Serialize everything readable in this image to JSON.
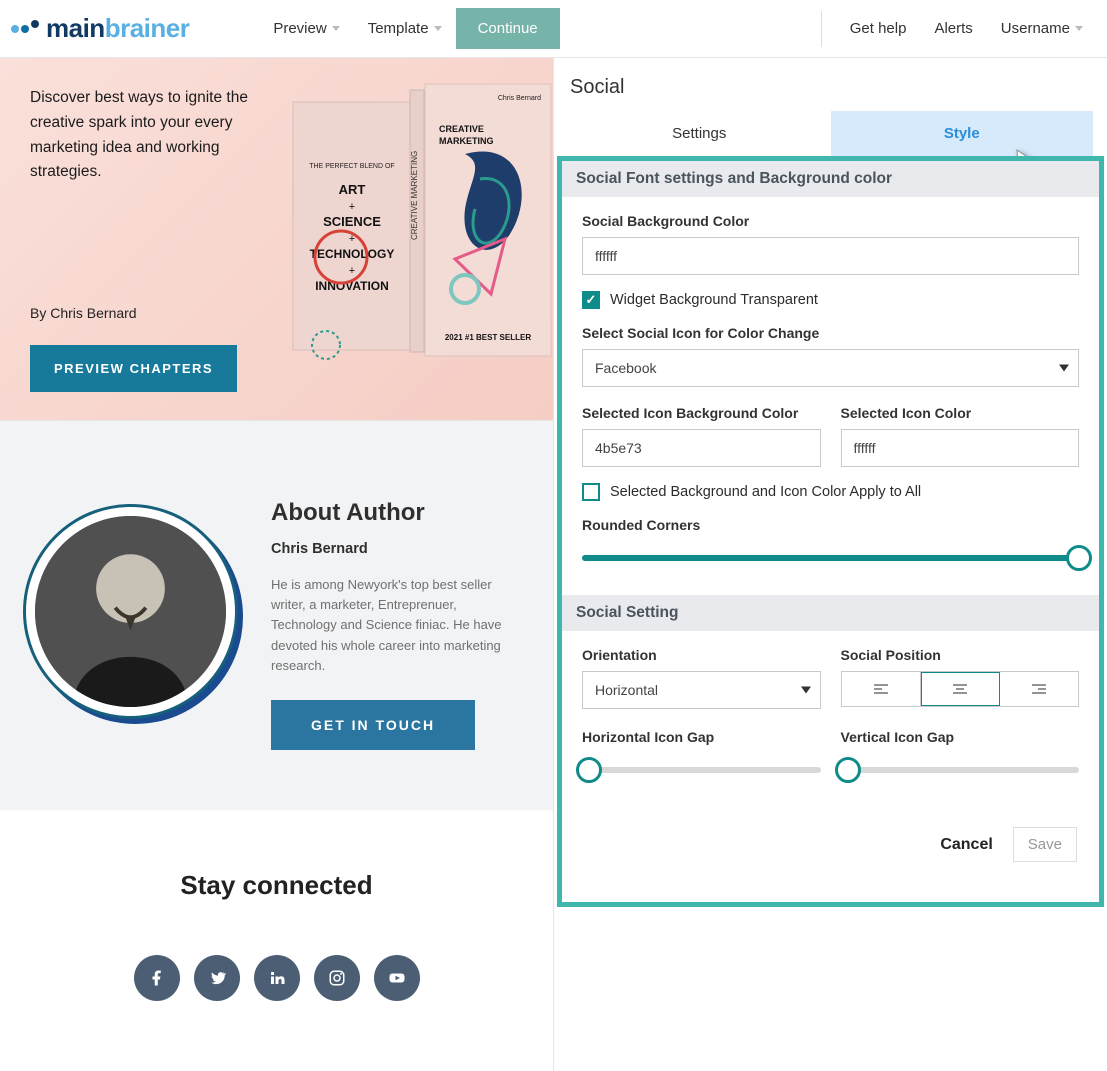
{
  "logo": {
    "main": "main",
    "sub": "brainer"
  },
  "topnav": {
    "preview": "Preview",
    "template": "Template",
    "continue": "Continue"
  },
  "topright": {
    "help": "Get help",
    "alerts": "Alerts",
    "user": "Username"
  },
  "hero": {
    "text": "Discover best ways to ignite the creative spark into your every marketing idea and working strategies.",
    "by": "By Chris Bernard",
    "button": "PREVIEW CHAPTERS",
    "book": {
      "small_author": "Chris Bernard",
      "small_title": "CREATIVE MARKETING",
      "small_badge": "2021 #1 BEST SELLER",
      "big_subtitle": "THE PERFECT BLEND OF",
      "big_lines": "ART\n+\nSCIENCE\n+\nTECHNOLOGY\n+\nINNOVATION"
    }
  },
  "author": {
    "heading": "About Author",
    "name": "Chris Bernard",
    "desc": "He is among Newyork's top best seller writer, a marketer, Entreprenuer, Technology and Science finiac. He have devoted his whole career into marketing research.",
    "button": "GET IN TOUCH"
  },
  "stay": {
    "heading": "Stay connected"
  },
  "panel": {
    "title": "Social",
    "tab_settings": "Settings",
    "tab_style": "Style",
    "sec1": "Social Font settings and Background color",
    "bg_label": "Social Background Color",
    "bg_value": "ffffff",
    "chk1": "Widget Background Transparent",
    "select_label": "Select Social Icon for Color Change",
    "select_value": "Facebook",
    "iconbg_label": "Selected Icon Background Color",
    "iconbg_value": "4b5e73",
    "iconcolor_label": "Selected Icon Color",
    "iconcolor_value": "ffffff",
    "chk2": "Selected Background and Icon Color Apply to All",
    "rounded_label": "Rounded Corners",
    "sec2": "Social Setting",
    "orient_label": "Orientation",
    "orient_value": "Horizontal",
    "pos_label": "Social Position",
    "hgap_label": "Horizontal Icon Gap",
    "vgap_label": "Vertical Icon Gap",
    "cancel": "Cancel",
    "save": "Save"
  }
}
